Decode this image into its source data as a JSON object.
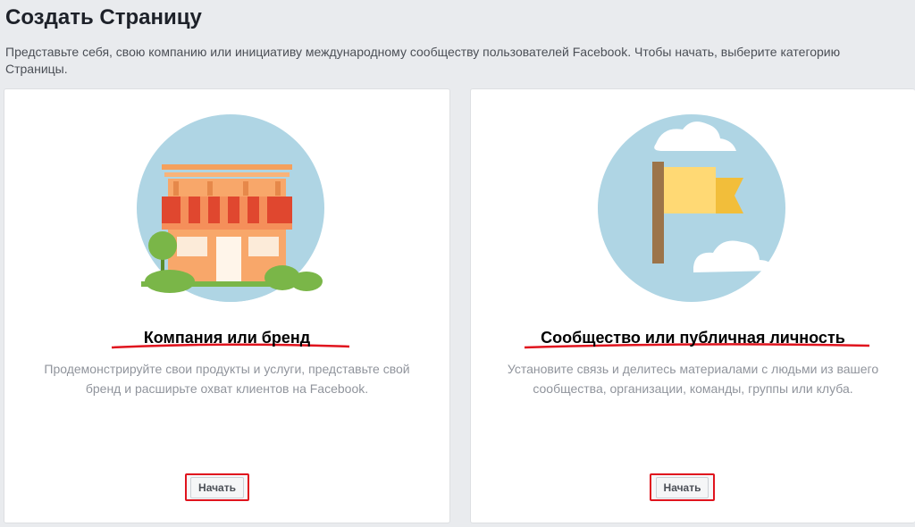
{
  "page": {
    "title": "Создать Страницу",
    "intro": "Представьте себя, свою компанию или инициативу международному сообществу пользователей Facebook. Чтобы начать, выберите категорию Страницы."
  },
  "cards": [
    {
      "title": "Компания или бренд",
      "description": "Продемонстрируйте свои продукты и услуги, представьте свой бренд и расширьте охват клиентов на Facebook.",
      "button": "Начать",
      "icon": "storefront-icon"
    },
    {
      "title": "Сообщество или публичная личность",
      "description": "Установите связь и делитесь материалами с людьми из вашего сообщества, организации, команды, группы или клуба.",
      "button": "Начать",
      "icon": "flag-icon"
    }
  ],
  "colors": {
    "page_bg": "#e9ebee",
    "card_bg": "#ffffff",
    "circle": "#afd5e4",
    "annotation_red": "#e0141e",
    "awning_red": "#e0472f",
    "store_orange": "#f8a76a",
    "tree_green": "#7ab648",
    "flag_yellow": "#ffd974",
    "flag_pole": "#9c7449"
  }
}
